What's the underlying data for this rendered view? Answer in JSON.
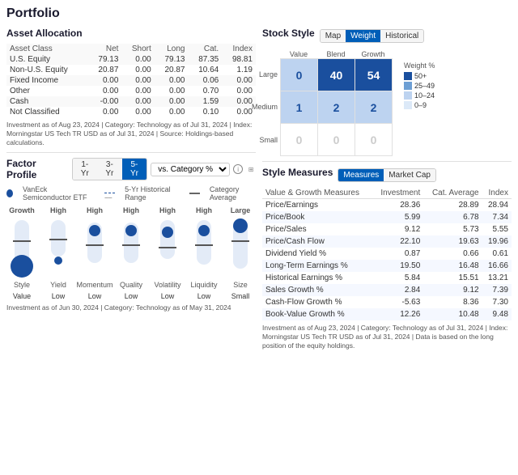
{
  "page": {
    "title": "Portfolio"
  },
  "assetAllocation": {
    "title": "Asset Allocation",
    "headers": [
      "Asset Class",
      "Net",
      "Short",
      "Long",
      "Cat.",
      "Index"
    ],
    "rows": [
      [
        "U.S. Equity",
        "79.13",
        "0.00",
        "79.13",
        "87.35",
        "98.81"
      ],
      [
        "Non-U.S. Equity",
        "20.87",
        "0.00",
        "20.87",
        "10.64",
        "1.19"
      ],
      [
        "Fixed Income",
        "0.00",
        "0.00",
        "0.00",
        "0.06",
        "0.00"
      ],
      [
        "Other",
        "0.00",
        "0.00",
        "0.00",
        "0.70",
        "0.00"
      ],
      [
        "Cash",
        "-0.00",
        "0.00",
        "0.00",
        "1.59",
        "0.00"
      ],
      [
        "Not Classified",
        "0.00",
        "0.00",
        "0.00",
        "0.10",
        "0.00"
      ]
    ],
    "footnote": "Investment as of Aug 23, 2024 | Category: Technology as of Jul 31, 2024 | Index: Morningstar US Tech TR USD as of Jul 31, 2024 | Source: Holdings-based calculations."
  },
  "factorProfile": {
    "title": "Factor Profile",
    "tabs": [
      "1-Yr",
      "3-Yr",
      "5-Yr"
    ],
    "activeTab": "5-Yr",
    "dropdown": "vs. Category %",
    "legend": {
      "dot": "VanEck Semiconductor ETF",
      "dotColor": "#1a4f9e",
      "line": "5-Yr Historical Range",
      "catLine": "Category Average"
    },
    "columns": [
      {
        "label": "Style",
        "topVal": "Growth",
        "bottomVal": "Value"
      },
      {
        "label": "Yield",
        "topVal": "High",
        "bottomVal": "Low"
      },
      {
        "label": "Momentum",
        "topVal": "High",
        "bottomVal": "Low"
      },
      {
        "label": "Quality",
        "topVal": "High",
        "bottomVal": "Low"
      },
      {
        "label": "Volatility",
        "topVal": "High",
        "bottomVal": "Low"
      },
      {
        "label": "Liquidity",
        "topVal": "High",
        "bottomVal": "Low"
      },
      {
        "label": "Size",
        "topVal": "Large",
        "bottomVal": "Small"
      }
    ],
    "footnote": "Investment as of Jun 30, 2024 | Category: Technology as of May 31, 2024"
  },
  "stockStyle": {
    "title": "Stock Style",
    "tabs": [
      "Map",
      "Weight",
      "Historical"
    ],
    "activeTab": "Weight",
    "colLabels": [
      "Value",
      "Blend",
      "Growth"
    ],
    "rowLabels": [
      "Large",
      "Medium",
      "Small"
    ],
    "cells": [
      [
        {
          "val": "0",
          "type": "light"
        },
        {
          "val": "40",
          "type": "dark"
        },
        {
          "val": "54",
          "type": "dark"
        }
      ],
      [
        {
          "val": "1",
          "type": "light"
        },
        {
          "val": "2",
          "type": "light"
        },
        {
          "val": "2",
          "type": "light"
        }
      ],
      [
        {
          "val": "0",
          "type": "empty"
        },
        {
          "val": "0",
          "type": "empty"
        },
        {
          "val": "0",
          "type": "empty"
        }
      ]
    ],
    "weightLegend": {
      "title": "Weight %",
      "items": [
        {
          "color": "#1a4f9e",
          "label": "50+"
        },
        {
          "color": "#6d9fd4",
          "label": "25–49"
        },
        {
          "color": "#bdd3f0",
          "label": "10–24"
        },
        {
          "color": "#dce9f8",
          "label": "0–9"
        }
      ]
    }
  },
  "styleMeasures": {
    "title": "Style Measures",
    "tabs": [
      "Measures",
      "Market Cap"
    ],
    "activeTab": "Measures",
    "headers": [
      "Value & Growth Measures",
      "Investment",
      "Cat. Average",
      "Index"
    ],
    "rows": [
      [
        "Price/Earnings",
        "28.36",
        "28.89",
        "28.94"
      ],
      [
        "Price/Book",
        "5.99",
        "6.78",
        "7.34"
      ],
      [
        "Price/Sales",
        "9.12",
        "5.73",
        "5.55"
      ],
      [
        "Price/Cash Flow",
        "22.10",
        "19.63",
        "19.96"
      ],
      [
        "Dividend Yield %",
        "0.87",
        "0.66",
        "0.61"
      ],
      [
        "Long-Term Earnings %",
        "19.50",
        "16.48",
        "16.66"
      ],
      [
        "Historical Earnings %",
        "5.84",
        "15.51",
        "13.21"
      ],
      [
        "Sales Growth %",
        "2.84",
        "9.12",
        "7.39"
      ],
      [
        "Cash-Flow Growth %",
        "-5.63",
        "8.36",
        "7.30"
      ],
      [
        "Book-Value Growth %",
        "12.26",
        "10.48",
        "9.48"
      ]
    ],
    "footnote": "Investment as of Aug 23, 2024 | Category: Technology as of Jul 31, 2024 | Index: Morningstar US Tech TR USD as of Jul 31, 2024 | Data is based on the long position of the equity holdings."
  }
}
